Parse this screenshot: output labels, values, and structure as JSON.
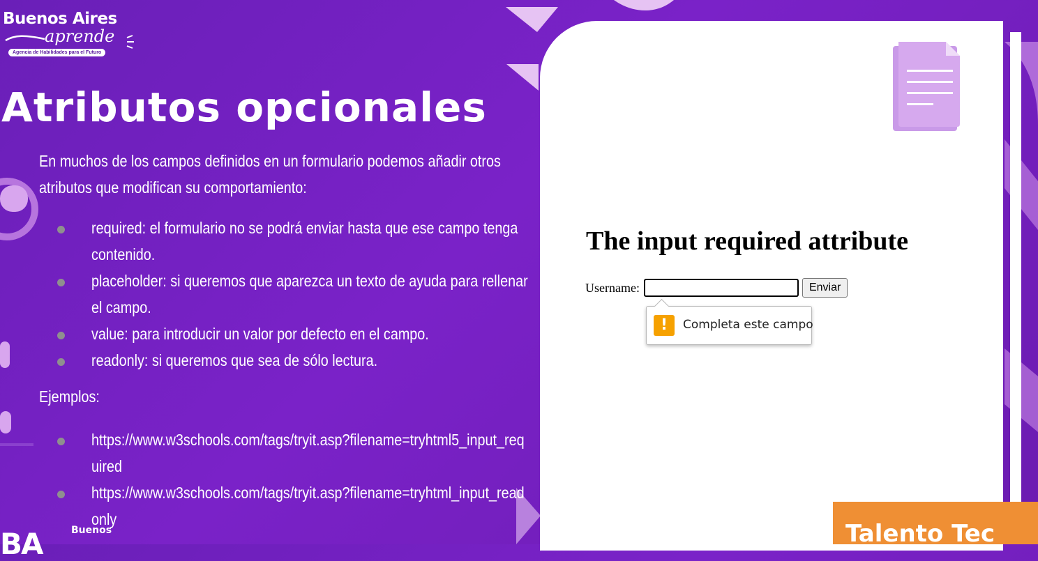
{
  "logo": {
    "top_text": "Buenos Aires",
    "script_text": "aprende",
    "tagline": "Agencia de Habilidades para el Futuro"
  },
  "slide": {
    "title": "Atributos opcionales",
    "intro": "En muchos de los campos definidos en un formulario podemos añadir otros atributos que modifican su comportamiento:",
    "attributes": [
      "required: el formulario no se podrá enviar hasta que ese campo tenga contenido.",
      "placeholder: si queremos que aparezca un texto de ayuda para rellenar el campo.",
      "value: para introducir un valor por defecto en el campo.",
      "readonly: si queremos que sea de sólo lectura."
    ],
    "examples_label": "Ejemplos:",
    "example_links": [
      "https://www.w3schools.com/tags/tryit.asp?filename=tryhtml5_input_required",
      "https://www.w3schools.com/tags/tryit.asp?filename=tryhtml_input_readonly"
    ]
  },
  "demo": {
    "heading": "The input required attribute",
    "label": "Username:",
    "input_value": "",
    "button_label": "Enviar",
    "validation_message": "Completa este campo"
  },
  "footer": {
    "ba_mark": "BA",
    "small_text": "Buenos",
    "badge": "Talento Tec"
  },
  "colors": {
    "background": "#7a22c8",
    "accent_pink": "#d49bea",
    "warning": "#f6a100",
    "badge": "#ef8f34"
  }
}
